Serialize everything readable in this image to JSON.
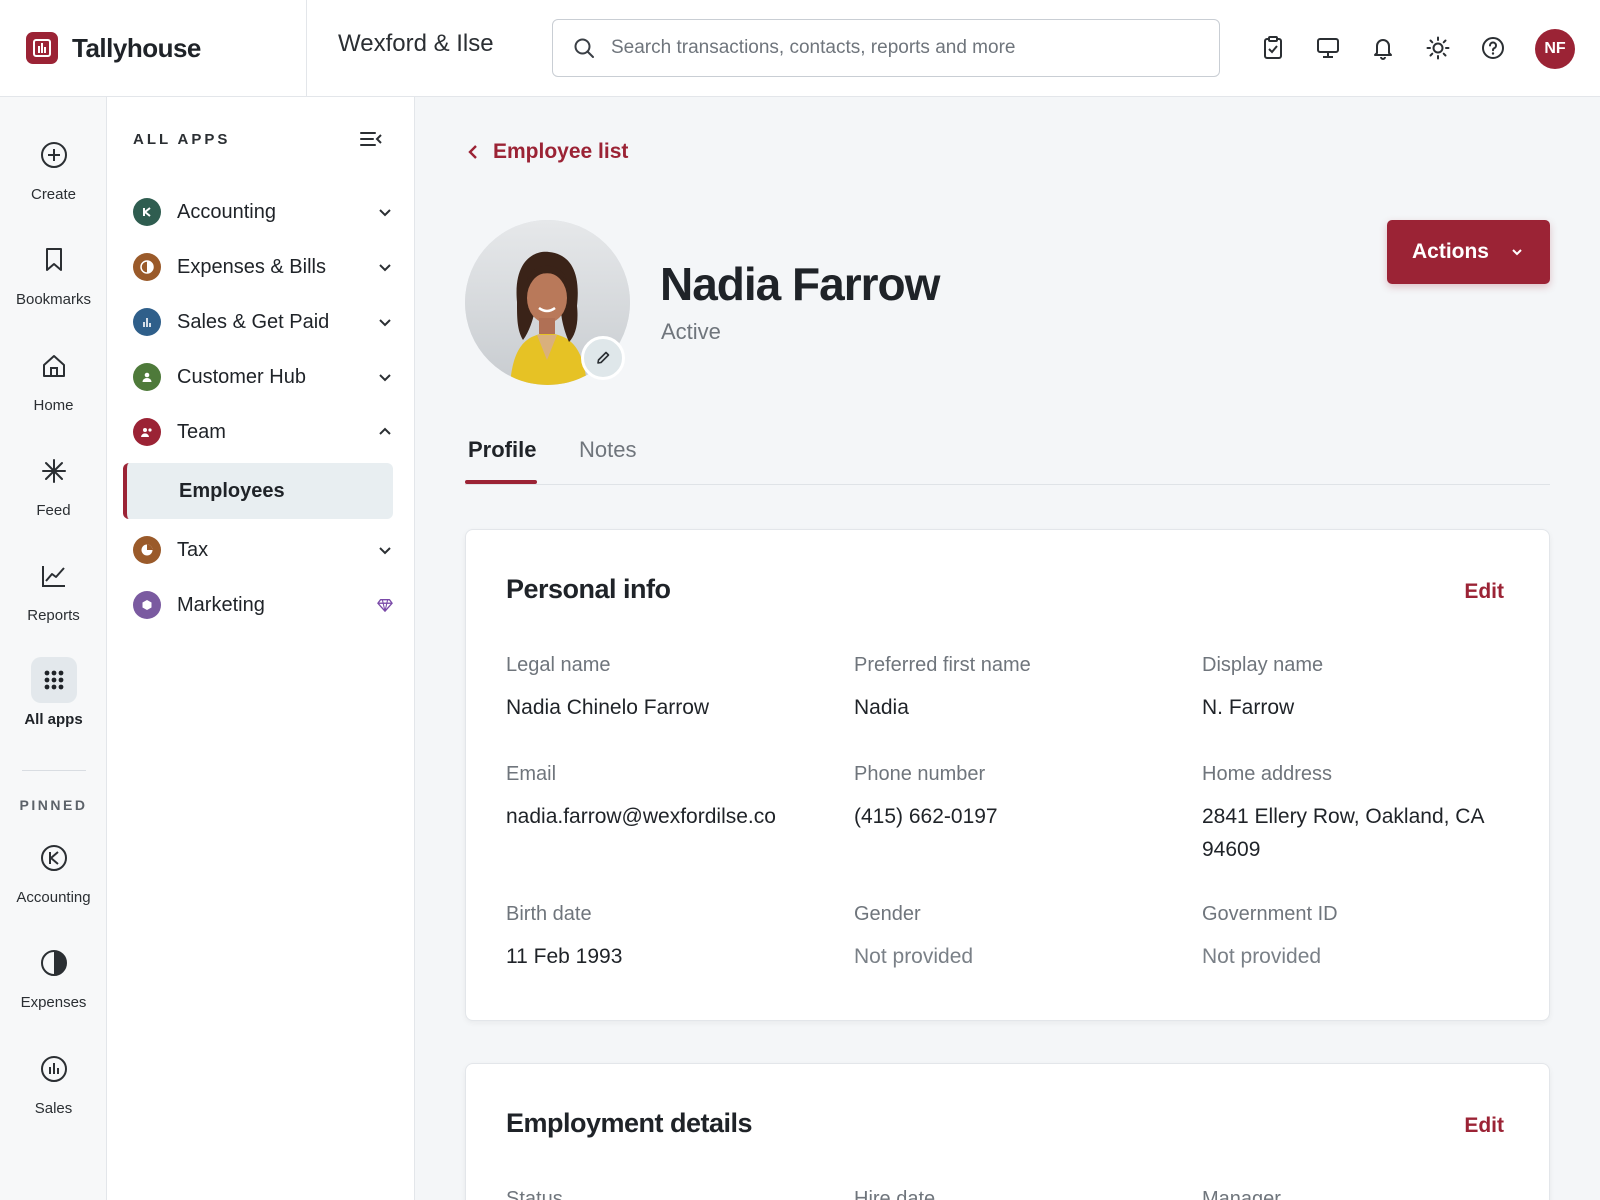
{
  "brand": {
    "name": "Tallyhouse"
  },
  "company": {
    "name": "Wexford & Ilse"
  },
  "search": {
    "placeholder": "Search transactions, contacts, reports and more"
  },
  "user": {
    "initials": "NF"
  },
  "rail": {
    "items": [
      {
        "label": "Create"
      },
      {
        "label": "Bookmarks"
      },
      {
        "label": "Home"
      },
      {
        "label": "Feed"
      },
      {
        "label": "Reports"
      },
      {
        "label": "All apps"
      }
    ],
    "pinned_label": "PINNED",
    "pinned": [
      {
        "label": "Accounting"
      },
      {
        "label": "Expenses"
      },
      {
        "label": "Sales"
      }
    ]
  },
  "apps": {
    "title": "ALL APPS",
    "items": [
      {
        "label": "Accounting",
        "color": "#2f5d50"
      },
      {
        "label": "Expenses & Bills",
        "color": "#9a5a2a"
      },
      {
        "label": "Sales & Get Paid",
        "color": "#2f5f8a"
      },
      {
        "label": "Customer Hub",
        "color": "#4e7a3a"
      },
      {
        "label": "Team",
        "color": "#9b2335"
      },
      {
        "label": "Employees"
      },
      {
        "label": "Tax",
        "color": "#9a5a2a"
      },
      {
        "label": "Marketing",
        "color": "#7a5aa0"
      }
    ]
  },
  "main": {
    "back_label": "Employee list",
    "employee": {
      "name": "Nadia Farrow",
      "status": "Active"
    },
    "actions_label": "Actions",
    "tabs": [
      {
        "label": "Profile"
      },
      {
        "label": "Notes"
      }
    ],
    "personal": {
      "title": "Personal info",
      "edit": "Edit",
      "fields": [
        {
          "label": "Legal name",
          "value": "Nadia Chinelo Farrow"
        },
        {
          "label": "Preferred first name",
          "value": "Nadia"
        },
        {
          "label": "Display name",
          "value": "N. Farrow"
        },
        {
          "label": "Email",
          "value": "nadia.farrow@wexfordilse.co"
        },
        {
          "label": "Phone number",
          "value": "(415) 662-0197"
        },
        {
          "label": "Home address",
          "value": "2841 Ellery Row, Oakland, CA 94609"
        },
        {
          "label": "Birth date",
          "value": "11 Feb 1993"
        },
        {
          "label": "Gender",
          "value": "Not provided"
        },
        {
          "label": "Government ID",
          "value": "Not provided"
        }
      ]
    },
    "employment": {
      "title": "Employment details",
      "edit": "Edit",
      "fields": [
        {
          "label": "Status"
        },
        {
          "label": "Hire date"
        },
        {
          "label": "Manager"
        }
      ]
    }
  },
  "colors": {
    "accent": "#9b2335"
  }
}
